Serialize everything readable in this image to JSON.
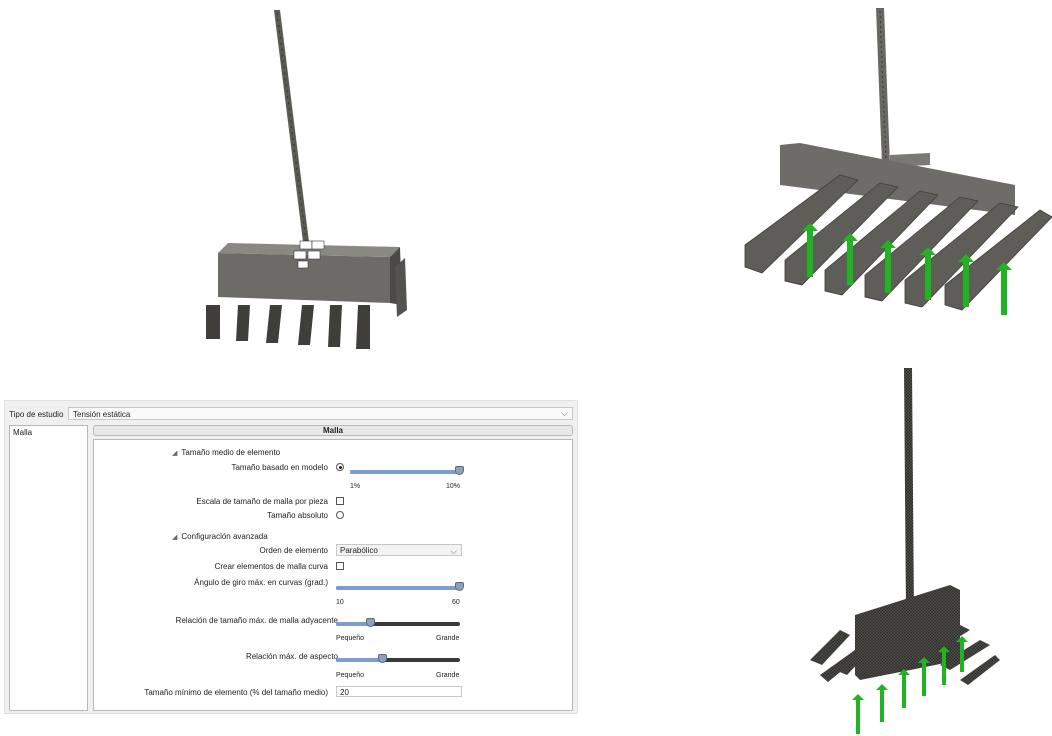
{
  "study": {
    "label": "Tipo de estudio",
    "value": "Tensión estática"
  },
  "sidebar": {
    "items": [
      {
        "label": "Malla"
      }
    ]
  },
  "panel": {
    "title": "Malla",
    "section_avg": "Tamaño medio de elemento",
    "size_model_label": "Tamaño basado en modelo",
    "size_model_selected": true,
    "size_slider": {
      "value": 10,
      "min_label": "1%",
      "max_label": "10%"
    },
    "scale_per_part_label": "Escala de tamaño de malla por pieza",
    "scale_per_part_checked": false,
    "absolute_size_label": "Tamaño absoluto",
    "absolute_size_selected": false,
    "section_advanced": "Configuración avanzada",
    "element_order_label": "Orden de elemento",
    "element_order_value": "Parabólico",
    "curved_label": "Crear elementos de malla curva",
    "curved_checked": false,
    "max_turn_label": "Ángulo de giro máx. en curvas (grad.)",
    "max_turn": {
      "value": 60,
      "min_label": "10",
      "max_label": "60",
      "fraction": 1.0
    },
    "adjacent_label": "Relación de tamaño máx. de malla adyacente",
    "adjacent": {
      "min_label": "Pequeño",
      "max_label": "Grande",
      "fraction": 0.28
    },
    "aspect_label": "Relación máx. de aspecto",
    "aspect": {
      "min_label": "Pequeño",
      "max_label": "Grande",
      "fraction": 0.38
    },
    "min_size_label": "Tamaño mínimo de elemento (% del tamaño medio)",
    "min_size_value": "20"
  },
  "colors": {
    "accent": "#7f9bd0",
    "arrow": "#22b322",
    "model": "#6f6d66"
  },
  "icons": {
    "collapse": "collapse-triangle-icon",
    "dropdown": "chevron-down-icon"
  }
}
